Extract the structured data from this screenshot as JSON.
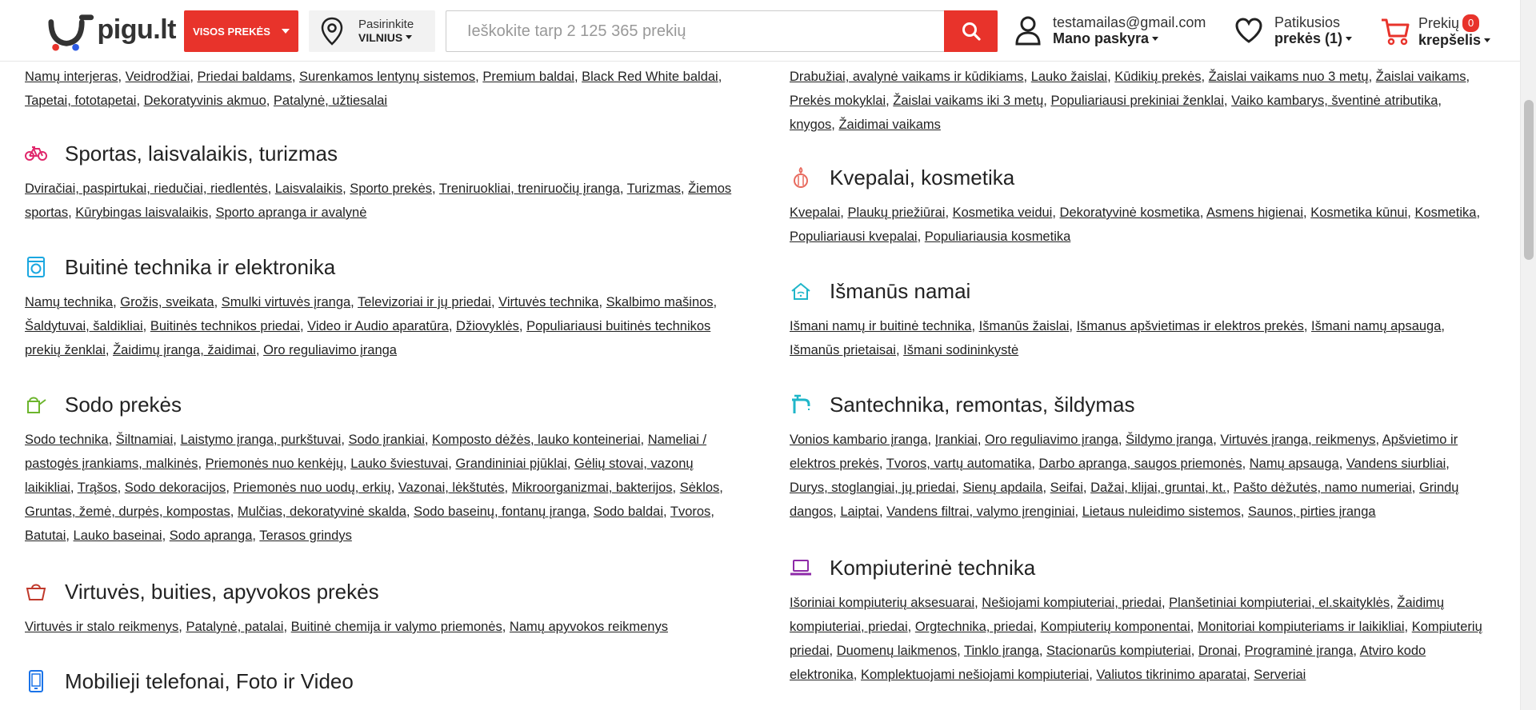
{
  "header": {
    "logo_text": "pigu.lt",
    "all_products_label": "VISOS PREKĖS",
    "location": {
      "line1": "Pasirinkite",
      "city": "VILNIUS"
    },
    "search": {
      "placeholder": "Ieškokite tarp 2 125 365 prekių"
    },
    "account": {
      "email": "testamailas@gmail.com",
      "label": "Mano paskyra"
    },
    "favorites": {
      "line1": "Patikusios",
      "line2": "prekės (1)"
    },
    "cart": {
      "line1": "Prekių",
      "count": "0",
      "line2": "krepšelis"
    }
  },
  "colors": {
    "accent": "#e8332b"
  },
  "left_column": [
    {
      "title": "",
      "icon": "",
      "links": [
        "Namų interjeras",
        "Veidrodžiai",
        "Priedai baldams",
        "Surenkamos lentynų sistemos",
        "Premium baldai",
        "Black Red White baldai",
        "Tapetai, fototapetai",
        "Dekoratyvinis akmuo",
        "Patalynė, užtiesalai"
      ]
    },
    {
      "title": "Sportas, laisvalaikis, turizmas",
      "icon": "bicycle-icon",
      "links": [
        "Dviračiai, paspirtukai, riedučiai, riedlentės",
        "Laisvalaikis",
        "Sporto prekės",
        "Treniruokliai, treniruočių įranga",
        "Turizmas",
        "Žiemos sportas",
        "Kūrybingas laisvalaikis",
        "Sporto apranga ir avalynė"
      ]
    },
    {
      "title": "Buitinė technika ir elektronika",
      "icon": "washing-machine-icon",
      "links": [
        "Namų technika",
        "Grožis, sveikata",
        "Smulki virtuvės įranga",
        "Televizoriai ir jų priedai",
        "Virtuvės technika",
        "Skalbimo mašinos",
        "Šaldytuvai, šaldikliai",
        "Buitinės technikos priedai",
        "Video ir Audio aparatūra",
        "Džiovyklės",
        "Populiariausi buitinės technikos prekių ženklai",
        "Žaidimų įranga, žaidimai",
        "Oro reguliavimo įranga"
      ]
    },
    {
      "title": "Sodo prekės",
      "icon": "watering-can-icon",
      "links": [
        "Sodo technika",
        "Šiltnamiai",
        "Laistymo įranga, purkštuvai",
        "Sodo įrankiai",
        "Komposto dėžės, lauko konteineriai",
        "Nameliai / pastogės įrankiams, malkinės",
        "Priemonės nuo kenkėjų",
        "Lauko šviestuvai",
        "Grandininiai pjūklai",
        "Gėlių stovai, vazonų laikikliai",
        "Trąšos",
        "Sodo dekoracijos",
        "Priemonės nuo uodų, erkių",
        "Vazonai, lėkštutės",
        "Mikroorganizmai, bakterijos",
        "Sėklos",
        "Gruntas, žemė, durpės, kompostas",
        "Mulčias, dekoratyvinė skalda",
        "Sodo baseinų, fontanų įranga",
        "Sodo baldai",
        "Tvoros",
        "Batutai",
        "Lauko baseinai",
        "Sodo apranga",
        "Terasos grindys"
      ]
    },
    {
      "title": "Virtuvės, buities, apyvokos prekės",
      "icon": "basket-icon",
      "links": [
        "Virtuvės ir stalo reikmenys",
        "Patalynė, patalai",
        "Buitinė chemija ir valymo priemonės",
        "Namų apyvokos reikmenys"
      ]
    },
    {
      "title": "Mobilieji telefonai, Foto ir Video",
      "icon": "smartphone-icon",
      "links": []
    }
  ],
  "right_column": [
    {
      "title": "",
      "icon": "",
      "links": [
        "Drabužiai, avalynė vaikams ir kūdikiams",
        "Lauko žaislai",
        "Kūdikių prekės",
        "Žaislai vaikams nuo 3 metų",
        "Žaislai vaikams",
        "Prekės mokyklai",
        "Žaislai vaikams iki 3 metų",
        "Populiariausi prekiniai ženklai",
        "Vaiko kambarys, šventinė atributika, knygos",
        "Žaidimai vaikams"
      ]
    },
    {
      "title": "Kvepalai, kosmetika",
      "icon": "perfume-icon",
      "links": [
        "Kvepalai",
        "Plaukų priežiūrai",
        "Kosmetika veidui",
        "Dekoratyvinė kosmetika",
        "Asmens higienai",
        "Kosmetika kūnui",
        "Kosmetika",
        "Populiariausi kvepalai",
        "Populiariausia kosmetika"
      ]
    },
    {
      "title": "Išmanūs namai",
      "icon": "smart-home-icon",
      "links": [
        "Išmani namų ir buitinė technika",
        "Išmanūs žaislai",
        "Išmanus apšvietimas ir elektros prekės",
        "Išmani namų apsauga",
        "Išmanūs prietaisai",
        "Išmani sodininkystė"
      ]
    },
    {
      "title": "Santechnika, remontas, šildymas",
      "icon": "faucet-icon",
      "links": [
        "Vonios kambario įranga",
        "Įrankiai",
        "Oro reguliavimo įranga",
        "Šildymo įranga",
        "Virtuvės įranga, reikmenys",
        "Apšvietimo ir elektros prekės",
        "Tvoros, vartų automatika",
        "Darbo apranga, saugos priemonės",
        "Namų apsauga",
        "Vandens siurbliai",
        "Durys, stoglangiai, jų priedai",
        "Sienų apdaila",
        "Seifai",
        "Dažai, klijai, gruntai, kt.",
        "Pašto dėžutės, namo numeriai",
        "Grindų dangos",
        "Laiptai",
        "Vandens filtrai, valymo įrenginiai",
        "Lietaus nuleidimo sistemos",
        "Saunos, pirties įranga"
      ]
    },
    {
      "title": "Kompiuterinė technika",
      "icon": "laptop-icon",
      "links": [
        "Išoriniai kompiuterių aksesuarai",
        "Nešiojami kompiuteriai, priedai",
        "Planšetiniai kompiuteriai, el.skaityklės",
        "Žaidimų kompiuteriai, priedai",
        "Orgtechnika, priedai",
        "Kompiuterių komponentai",
        "Monitoriai kompiuteriams ir laikikliai",
        "Kompiuterių priedai",
        "Duomenų laikmenos",
        "Tinklo įranga",
        "Stacionarūs kompiuteriai",
        "Dronai",
        "Programinė įranga",
        "Atviro kodo elektronika",
        "Komplektuojami nešiojami kompiuteriai",
        "Valiutos tikrinimo aparatai",
        "Serveriai"
      ]
    }
  ]
}
